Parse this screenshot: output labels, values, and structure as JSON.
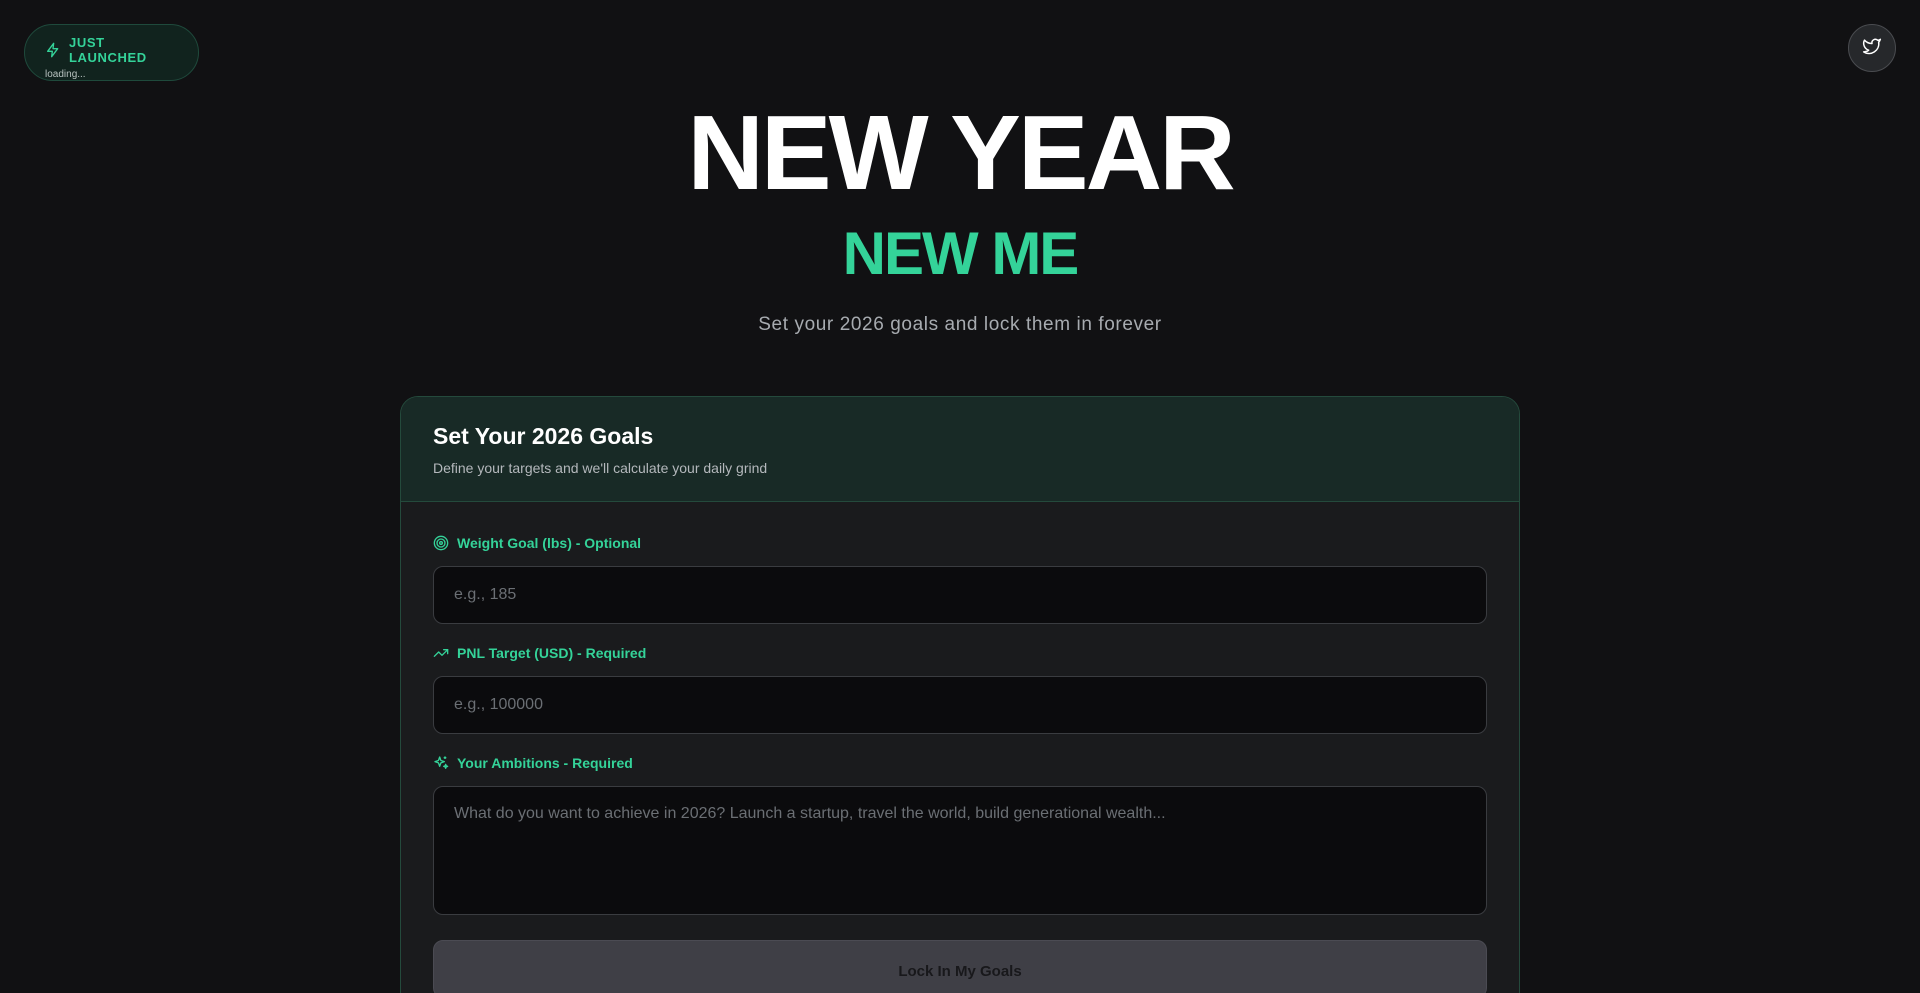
{
  "badge": {
    "title": "JUST LAUNCHED",
    "subtitle": "loading...",
    "icon": "bolt-icon"
  },
  "twitter": {
    "icon": "twitter-icon"
  },
  "hero": {
    "title": "NEW YEAR",
    "subtitle": "NEW ME",
    "tagline": "Set your 2026 goals and lock them in forever"
  },
  "card": {
    "title": "Set Your 2026 Goals",
    "description": "Define your targets and we'll calculate your daily grind",
    "fields": [
      {
        "label": "Weight Goal (lbs) - Optional",
        "placeholder": "e.g., 185",
        "value": "",
        "icon": "target-icon"
      },
      {
        "label": "PNL Target (USD) - Required",
        "placeholder": "e.g., 100000",
        "value": "",
        "icon": "trending-up-icon"
      },
      {
        "label": "Your Ambitions - Required",
        "placeholder": "What do you want to achieve in 2026? Launch a startup, travel the world, build generational wealth...",
        "value": "",
        "icon": "sparkles-icon"
      }
    ],
    "submit_label": "Lock In My Goals"
  },
  "colors": {
    "accent": "#34d399",
    "background": "#111113",
    "card_header": "#182a26",
    "button_disabled": "#3f3f46"
  }
}
